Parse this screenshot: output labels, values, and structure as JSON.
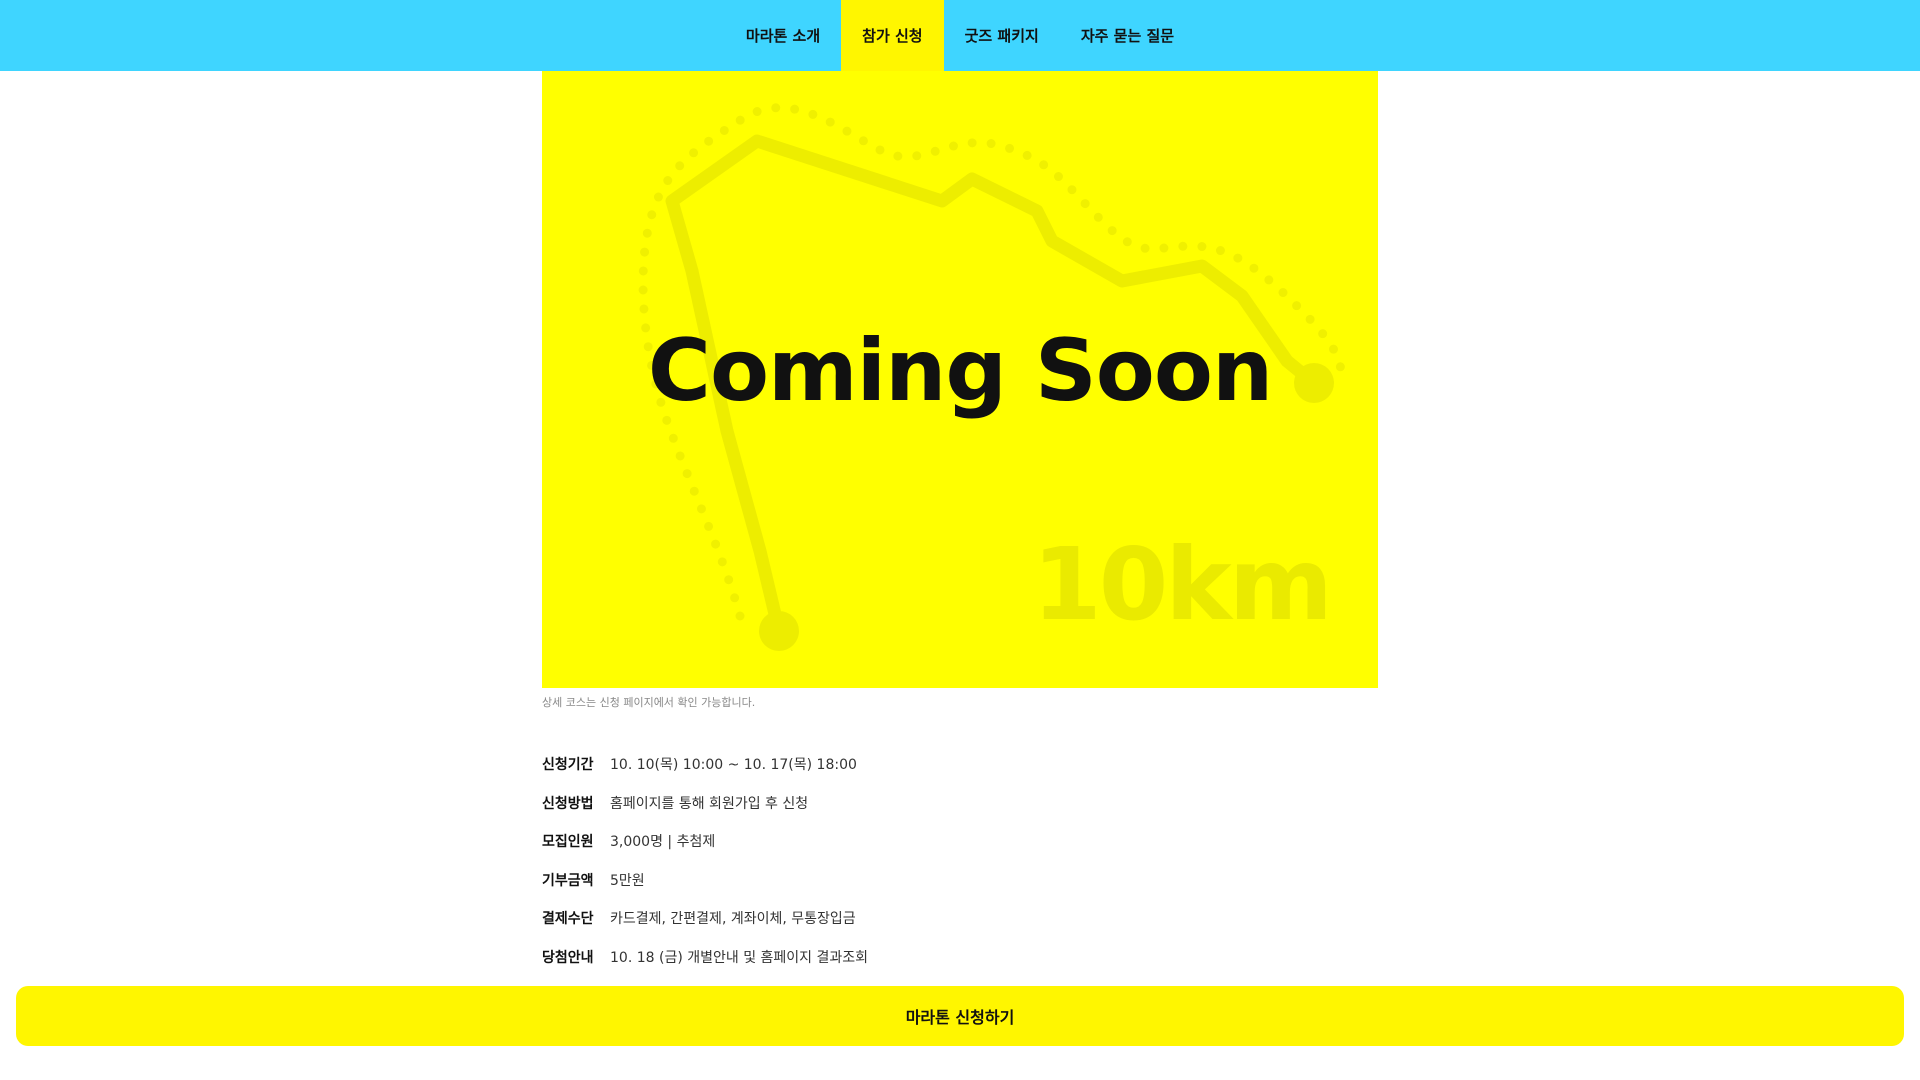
{
  "nav": {
    "items": [
      {
        "label": "마라톤 소개",
        "active": false
      },
      {
        "label": "참가 신청",
        "active": true
      },
      {
        "label": "굿즈 패키지",
        "active": false
      },
      {
        "label": "자주 묻는 질문",
        "active": false
      }
    ]
  },
  "hero": {
    "title": "Coming Soon",
    "distance": "10km",
    "caption": "상세 코스는 신청 페이지에서 확인 가능합니다."
  },
  "info": {
    "rows": [
      {
        "label": "신청기간",
        "value": "10. 10(목) 10:00 ~ 10. 17(목) 18:00"
      },
      {
        "label": "신청방법",
        "value": "홈페이지를 통해 회원가입 후 신청"
      },
      {
        "label": "모집인원",
        "value": "3,000명 | 추첨제"
      },
      {
        "label": "기부금액",
        "value": "5만원"
      },
      {
        "label": "결제수단",
        "value": "카드결제, 간편결제, 계좌이체, 무통장입금"
      },
      {
        "label": "당첨안내",
        "value": "10. 18 (금) 개별안내 및 홈페이지 결과조회"
      }
    ]
  },
  "cta": {
    "label": "마라톤 신청하기"
  },
  "colors": {
    "nav_bg": "#3fd5ff",
    "accent_yellow": "#fff600",
    "hero_bg": "#ffff00"
  }
}
